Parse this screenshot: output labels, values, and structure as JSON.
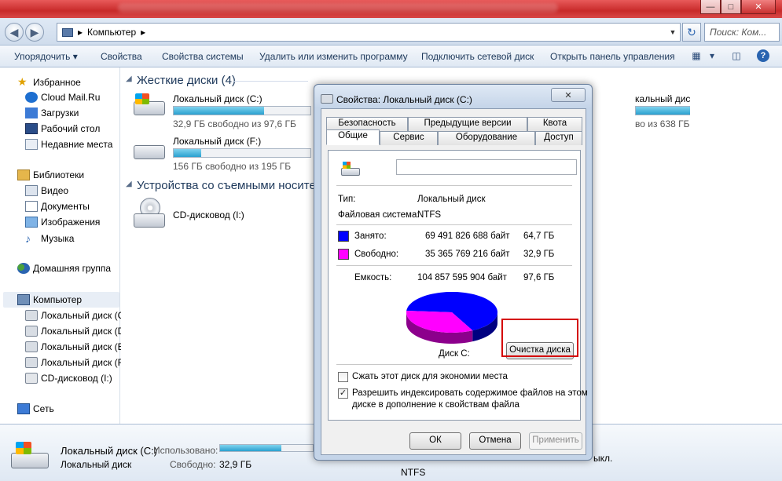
{
  "window": {
    "minimize_glyph": "—",
    "maximize_glyph": "□",
    "close_glyph": "✕"
  },
  "address": {
    "back_glyph": "◀",
    "forward_glyph": "▶",
    "path_separator": "▸",
    "path": "Компьютер",
    "path_arrow": "▸",
    "dropdown_glyph": "▼",
    "refresh_glyph": "↻",
    "search_placeholder": "Поиск: Ком..."
  },
  "toolbar": {
    "organize": "Упорядочить",
    "organize_arrow": "▾",
    "properties": "Свойства",
    "system_properties": "Свойства системы",
    "uninstall": "Удалить или изменить программу",
    "map_drive": "Подключить сетевой диск",
    "control_panel": "Открыть панель управления",
    "views_glyph": "▦",
    "views_arrow": "▾",
    "preview_glyph": "◫",
    "help_glyph": "?"
  },
  "sidebar": {
    "favorites": "Избранное",
    "favorites_items": [
      "Cloud Mail.Ru",
      "Загрузки",
      "Рабочий стол",
      "Недавние места"
    ],
    "libraries": "Библиотеки",
    "libraries_items": [
      "Видео",
      "Документы",
      "Изображения",
      "Музыка"
    ],
    "homegroup": "Домашняя группа",
    "computer": "Компьютер",
    "computer_items": [
      "Локальный диск (C:)",
      "Локальный диск (D",
      "Локальный диск (E:",
      "Локальный диск (F:",
      "CD-дисковод (I:)"
    ],
    "network": "Сеть",
    "star_glyph": "★",
    "music_glyph": "♪"
  },
  "content": {
    "group_hdd": "Жесткие диски (4)",
    "group_removable": "Устройства со съемными носителя",
    "collapse_glyph": "◢",
    "drives": [
      {
        "name": "Локальный диск (C:)",
        "free": "32,9 ГБ свободно из 97,6 ГБ",
        "used_fraction": 0.663
      },
      {
        "name": "Локальный диск (F:)",
        "free": "156 ГБ свободно из 195 ГБ",
        "used_fraction": 0.2
      },
      {
        "name": "кальный диск (E:)",
        "free": "во из 638 ГБ",
        "used_fraction": 0.75
      }
    ],
    "cd": "CD-дисковод (I:)"
  },
  "details": {
    "name": "Локальный диск (C:)",
    "type": "Локальный диск",
    "used_label": "Использовано:",
    "free_label": "Свободно:",
    "free_value": "32,9 ГБ",
    "fs_partial": "NTFS",
    "cut_text": "ыкл."
  },
  "dialog": {
    "title": "Свойства: Локальный диск (C:)",
    "close_glyph": "✕",
    "tabs_back": [
      "Безопасность",
      "Предыдущие версии",
      "Квота"
    ],
    "tabs_front": [
      "Общие",
      "Сервис",
      "Оборудование",
      "Доступ"
    ],
    "name_value": "",
    "type_label": "Тип:",
    "type_value": "Локальный диск",
    "fs_label": "Файловая система:",
    "fs_value": "NTFS",
    "used_label": "Занято:",
    "used_bytes": "69 491 826 688 байт",
    "used_gb": "64,7 ГБ",
    "free_label": "Свободно:",
    "free_bytes": "35 365 769 216 байт",
    "free_gb": "32,9 ГБ",
    "capacity_label": "Емкость:",
    "capacity_bytes": "104 857 595 904 байт",
    "capacity_gb": "97,6 ГБ",
    "used_color": "#0000ff",
    "free_color": "#ff00ff",
    "used_fraction": 0.663,
    "disk_label": "Диск C:",
    "cleanup": "Очистка диска",
    "compress": "Сжать этот диск для экономии места",
    "compress_checked": false,
    "index_line1": "Разрешить индексировать содержимое файлов на этом",
    "index_line2": "диске в дополнение к свойствам файла",
    "index_checked": true,
    "check_glyph": "✓",
    "ok": "ОК",
    "cancel": "Отмена",
    "apply": "Применить"
  },
  "highlight_color": "#d40000"
}
